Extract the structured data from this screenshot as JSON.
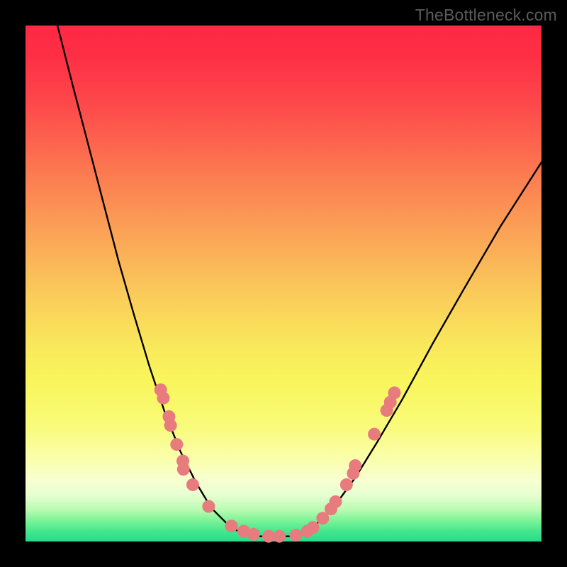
{
  "watermark": "TheBottleneck.com",
  "colors": {
    "frame": "#000000",
    "curve": "#000000",
    "marker_fill": "#e77b7d",
    "marker_stroke": "#d96a6c",
    "gradient_stops": [
      {
        "stop": 0.0,
        "hex": "#fe2842"
      },
      {
        "stop": 0.06,
        "hex": "#fe2f45"
      },
      {
        "stop": 0.16,
        "hex": "#fd4b4b"
      },
      {
        "stop": 0.28,
        "hex": "#fc7850"
      },
      {
        "stop": 0.4,
        "hex": "#fba256"
      },
      {
        "stop": 0.52,
        "hex": "#facb5a"
      },
      {
        "stop": 0.62,
        "hex": "#f9e85b"
      },
      {
        "stop": 0.69,
        "hex": "#f9f65b"
      },
      {
        "stop": 0.78,
        "hex": "#f9fb7c"
      },
      {
        "stop": 0.85,
        "hex": "#faffb4"
      },
      {
        "stop": 0.88,
        "hex": "#f8ffd0"
      },
      {
        "stop": 0.91,
        "hex": "#e7ffd1"
      },
      {
        "stop": 0.94,
        "hex": "#b6fbb0"
      },
      {
        "stop": 0.96,
        "hex": "#7af397"
      },
      {
        "stop": 0.98,
        "hex": "#45e78d"
      },
      {
        "stop": 1.0,
        "hex": "#25dc89"
      }
    ]
  },
  "chart_data": {
    "type": "scatter",
    "title": "",
    "xlabel": "",
    "ylabel": "",
    "xlim": [
      0,
      1
    ],
    "ylim": [
      0,
      1
    ],
    "grid": false,
    "legend": false,
    "note": "V-shaped bottleneck curve on rainbow gradient; x and y are normalized 0–1 within plot area (y=0 at bottom).",
    "curve_left": [
      {
        "x": 0.062,
        "y": 1.0
      },
      {
        "x": 0.09,
        "y": 0.89
      },
      {
        "x": 0.12,
        "y": 0.775
      },
      {
        "x": 0.15,
        "y": 0.66
      },
      {
        "x": 0.18,
        "y": 0.545
      },
      {
        "x": 0.21,
        "y": 0.44
      },
      {
        "x": 0.24,
        "y": 0.34
      },
      {
        "x": 0.27,
        "y": 0.25
      },
      {
        "x": 0.3,
        "y": 0.175
      },
      {
        "x": 0.33,
        "y": 0.115
      },
      {
        "x": 0.36,
        "y": 0.065
      },
      {
        "x": 0.4,
        "y": 0.025
      },
      {
        "x": 0.44,
        "y": 0.01
      }
    ],
    "curve_right": [
      {
        "x": 0.52,
        "y": 0.01
      },
      {
        "x": 0.56,
        "y": 0.03
      },
      {
        "x": 0.6,
        "y": 0.07
      },
      {
        "x": 0.64,
        "y": 0.125
      },
      {
        "x": 0.68,
        "y": 0.19
      },
      {
        "x": 0.73,
        "y": 0.275
      },
      {
        "x": 0.79,
        "y": 0.385
      },
      {
        "x": 0.85,
        "y": 0.49
      },
      {
        "x": 0.92,
        "y": 0.61
      },
      {
        "x": 1.0,
        "y": 0.735
      }
    ],
    "flat_bottom": {
      "x0": 0.44,
      "x1": 0.52,
      "y": 0.01
    },
    "markers": [
      {
        "x": 0.262,
        "y": 0.294
      },
      {
        "x": 0.267,
        "y": 0.278
      },
      {
        "x": 0.278,
        "y": 0.242
      },
      {
        "x": 0.281,
        "y": 0.225
      },
      {
        "x": 0.293,
        "y": 0.188
      },
      {
        "x": 0.305,
        "y": 0.156
      },
      {
        "x": 0.306,
        "y": 0.14
      },
      {
        "x": 0.324,
        "y": 0.11
      },
      {
        "x": 0.355,
        "y": 0.068
      },
      {
        "x": 0.399,
        "y": 0.03
      },
      {
        "x": 0.423,
        "y": 0.02
      },
      {
        "x": 0.442,
        "y": 0.014
      },
      {
        "x": 0.471,
        "y": 0.01
      },
      {
        "x": 0.492,
        "y": 0.01
      },
      {
        "x": 0.524,
        "y": 0.012
      },
      {
        "x": 0.546,
        "y": 0.02
      },
      {
        "x": 0.557,
        "y": 0.027
      },
      {
        "x": 0.576,
        "y": 0.045
      },
      {
        "x": 0.592,
        "y": 0.063
      },
      {
        "x": 0.601,
        "y": 0.077
      },
      {
        "x": 0.622,
        "y": 0.11
      },
      {
        "x": 0.635,
        "y": 0.132
      },
      {
        "x": 0.639,
        "y": 0.147
      },
      {
        "x": 0.676,
        "y": 0.208
      },
      {
        "x": 0.7,
        "y": 0.254
      },
      {
        "x": 0.707,
        "y": 0.27
      },
      {
        "x": 0.715,
        "y": 0.288
      }
    ]
  }
}
